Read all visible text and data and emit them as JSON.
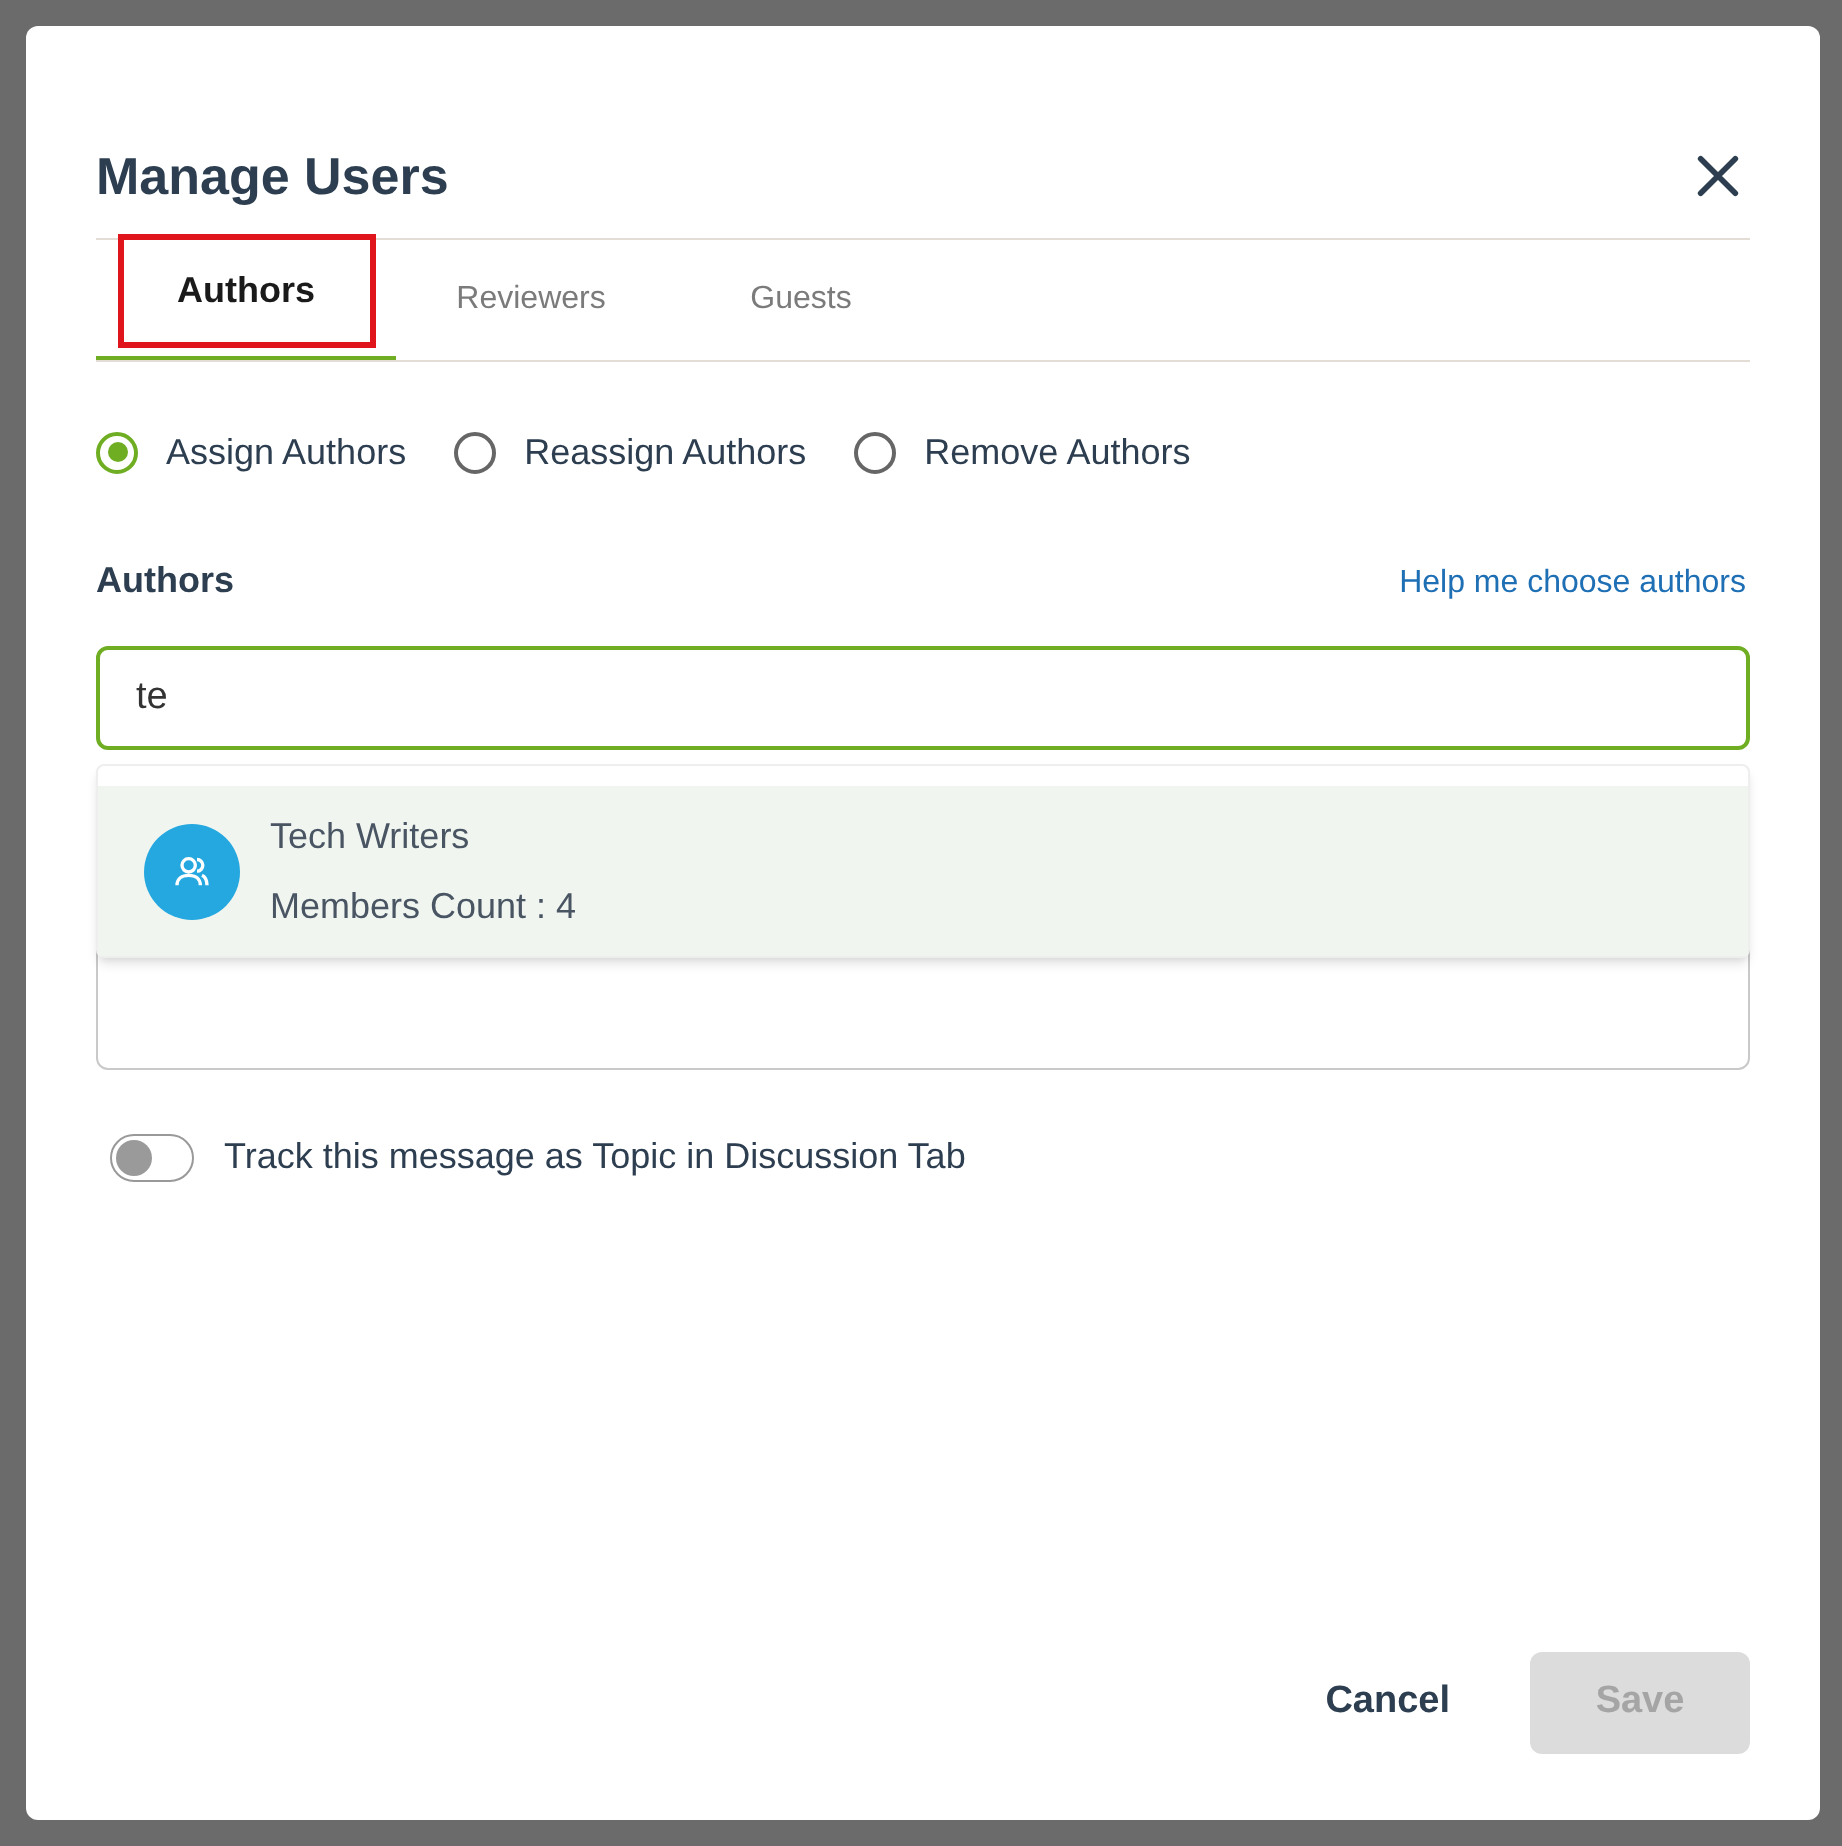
{
  "dialog": {
    "title": "Manage Users"
  },
  "tabs": [
    {
      "label": "Authors",
      "selected": true
    },
    {
      "label": "Reviewers",
      "selected": false
    },
    {
      "label": "Guests",
      "selected": false
    }
  ],
  "actions": [
    {
      "label": "Assign Authors",
      "selected": true
    },
    {
      "label": "Reassign Authors",
      "selected": false
    },
    {
      "label": "Remove Authors",
      "selected": false
    }
  ],
  "authors_field": {
    "label": "Authors",
    "help_link": "Help me choose authors",
    "value": "te"
  },
  "suggestions": [
    {
      "name": "Tech Writers",
      "detail": "Members Count : 4"
    }
  ],
  "track_toggle": {
    "label": "Track this message as Topic in Discussion Tab",
    "on": false
  },
  "buttons": [
    {
      "label": "Cancel",
      "disabled": false,
      "kind": "secondary"
    },
    {
      "label": "Save",
      "disabled": true,
      "kind": "primary"
    }
  ]
}
